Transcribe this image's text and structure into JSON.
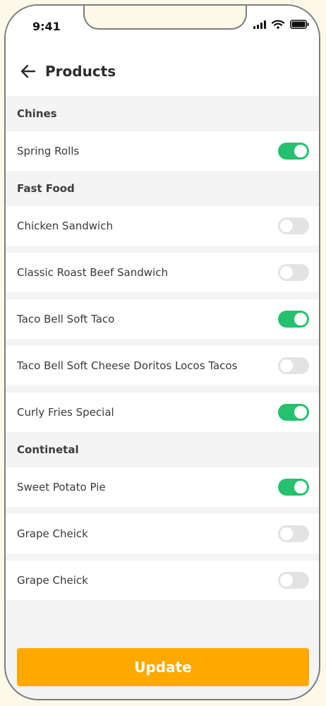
{
  "status": {
    "time": "9:41"
  },
  "header": {
    "title": "Products"
  },
  "sections": [
    {
      "title": "Chines",
      "items": [
        {
          "label": "Spring Rolls",
          "on": true
        }
      ]
    },
    {
      "title": "Fast Food",
      "items": [
        {
          "label": "Chicken Sandwich",
          "on": false
        },
        {
          "label": "Classic Roast Beef Sandwich",
          "on": false
        },
        {
          "label": "Taco Bell Soft Taco",
          "on": true
        },
        {
          "label": "Taco Bell Soft Cheese Doritos Locos Tacos",
          "on": false
        },
        {
          "label": "Curly Fries Special",
          "on": true
        }
      ]
    },
    {
      "title": "Continetal",
      "items": [
        {
          "label": "Sweet Potato Pie",
          "on": true
        },
        {
          "label": "Grape Cheick",
          "on": false
        },
        {
          "label": "Grape Cheick",
          "on": false
        }
      ]
    }
  ],
  "footer": {
    "update_label": "Update"
  },
  "colors": {
    "toggle_on": "#25c16f",
    "toggle_off": "#e3e3e3",
    "accent": "#ffa900"
  },
  "icons": {
    "back": "arrow-left-icon",
    "signal": "cellular-signal-icon",
    "wifi": "wifi-icon",
    "battery": "battery-icon"
  }
}
